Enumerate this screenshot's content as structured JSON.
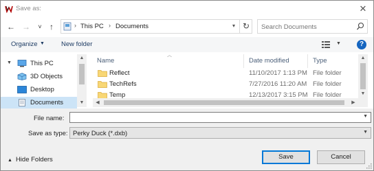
{
  "window": {
    "title": "Save as:",
    "close_glyph": "✕"
  },
  "nav": {
    "back": "←",
    "forward": "→",
    "recent": "˅",
    "up": "↑"
  },
  "address": {
    "crumbs": [
      "This PC",
      "Documents"
    ],
    "separator": "›",
    "refresh": "↻"
  },
  "search": {
    "placeholder": "Search Documents"
  },
  "toolbar": {
    "organize": "Organize",
    "new_folder": "New folder",
    "help": "?"
  },
  "sidebar": {
    "items": [
      {
        "label": "This PC",
        "icon": "computer-icon"
      },
      {
        "label": "3D Objects",
        "icon": "3d-objects-icon"
      },
      {
        "label": "Desktop",
        "icon": "desktop-icon"
      },
      {
        "label": "Documents",
        "icon": "documents-icon",
        "selected": true
      }
    ]
  },
  "file_list": {
    "columns": [
      "Name",
      "Date modified",
      "Type"
    ],
    "rows": [
      {
        "name": "Reflect",
        "date": "11/10/2017 1:13 PM",
        "type": "File folder"
      },
      {
        "name": "TechRefs",
        "date": "7/27/2016 11:20 AM",
        "type": "File folder"
      },
      {
        "name": "Temp",
        "date": "12/13/2017 3:15 PM",
        "type": "File folder"
      }
    ]
  },
  "form": {
    "file_name_label": "File name:",
    "file_name_value": "",
    "save_as_type_label": "Save as type:",
    "save_as_type_value": "Perky Duck (*.dxb)"
  },
  "footer": {
    "hide_folders": "Hide Folders",
    "save": "Save",
    "cancel": "Cancel"
  },
  "colors": {
    "accent": "#0078d7",
    "selection": "#cce4f7",
    "help": "#1565c0",
    "folder": "#f8d775"
  }
}
